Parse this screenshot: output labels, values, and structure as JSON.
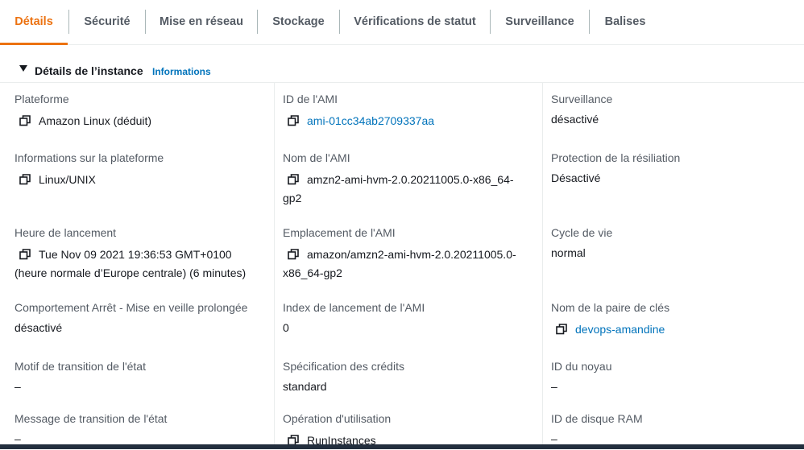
{
  "tabs": [
    {
      "label": "Détails",
      "active": true
    },
    {
      "label": "Sécurité"
    },
    {
      "label": "Mise en réseau"
    },
    {
      "label": "Stockage"
    },
    {
      "label": "Vérifications de statut"
    },
    {
      "label": "Surveillance"
    },
    {
      "label": "Balises"
    }
  ],
  "section": {
    "title": "Détails de l’instance",
    "info_link": "Informations"
  },
  "colors": {
    "accent": "#ec7211",
    "link": "#0073bb",
    "label": "#545b64"
  },
  "fields": {
    "plateforme": {
      "label": "Plateforme",
      "value": "Amazon Linux (déduit)"
    },
    "ami_id": {
      "label": "ID de l'AMI",
      "value": "ami-01cc34ab2709337aa"
    },
    "surveillance": {
      "label": "Surveillance",
      "value": "désactivé"
    },
    "info_plateforme": {
      "label": "Informations sur la plateforme",
      "value": "Linux/UNIX"
    },
    "ami_nom": {
      "label": "Nom de l'AMI",
      "value_line1": "amzn2-ami-hvm-2.0.20211005.0-x86_64-",
      "value_line2": "gp2"
    },
    "protection_resiliation": {
      "label": "Protection de la résiliation",
      "value": "Désactivé"
    },
    "heure_lancement": {
      "label": "Heure de lancement",
      "value_line1": "Tue Nov 09 2021 19:36:53 GMT+0100",
      "value_line2": "(heure normale d’Europe centrale) (6 minutes)"
    },
    "ami_emplacement": {
      "label": "Emplacement de l'AMI",
      "value_line1": "amazon/amzn2-ami-hvm-2.0.20211005.0-",
      "value_line2": "x86_64-gp2"
    },
    "cycle_vie": {
      "label": "Cycle de vie",
      "value": "normal"
    },
    "comportement_arret": {
      "label": "Comportement Arrêt - Mise en veille prolongée",
      "value": "désactivé"
    },
    "ami_index": {
      "label": "Index de lancement de l'AMI",
      "value": "0"
    },
    "paire_cles": {
      "label": "Nom de la paire de clés",
      "value": "devops-amandine"
    },
    "motif_transition": {
      "label": "Motif de transition de l'état",
      "value": "–"
    },
    "spec_credits": {
      "label": "Spécification des crédits",
      "value": "standard"
    },
    "id_noyau": {
      "label": "ID du noyau",
      "value": "–"
    },
    "message_transition": {
      "label": "Message de transition de l'état",
      "value": "–"
    },
    "operation_utilisation": {
      "label": "Opération d'utilisation",
      "value": "RunInstances"
    },
    "id_disque_ram": {
      "label": "ID de disque RAM",
      "value": "–"
    }
  }
}
